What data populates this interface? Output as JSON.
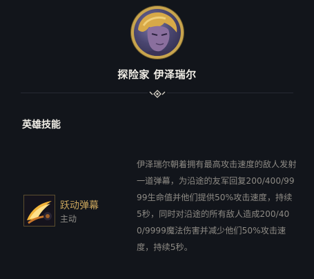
{
  "champion": {
    "name": "探险家 伊泽瑞尔",
    "portrait_icon": "ezreal-portrait"
  },
  "section": {
    "title": "英雄技能"
  },
  "ability": {
    "name": "跃动弹幕",
    "type": "主动",
    "icon": "barrage-skill-icon",
    "description": "伊泽瑞尔朝着拥有最高攻击速度的敌人发射一道弹幕，为沿途的友军回复200/400/9999生命值并他们提供50%攻击速度，持续5秒，同时对沿途的所有敌人造成200/400/9999魔法伤害并减少他们50%攻击速度，持续5秒。"
  },
  "colors": {
    "background": "#12151b",
    "gold": "#c8a44d",
    "ability_name": "#c9a55c",
    "text_muted": "#8d8a84"
  }
}
